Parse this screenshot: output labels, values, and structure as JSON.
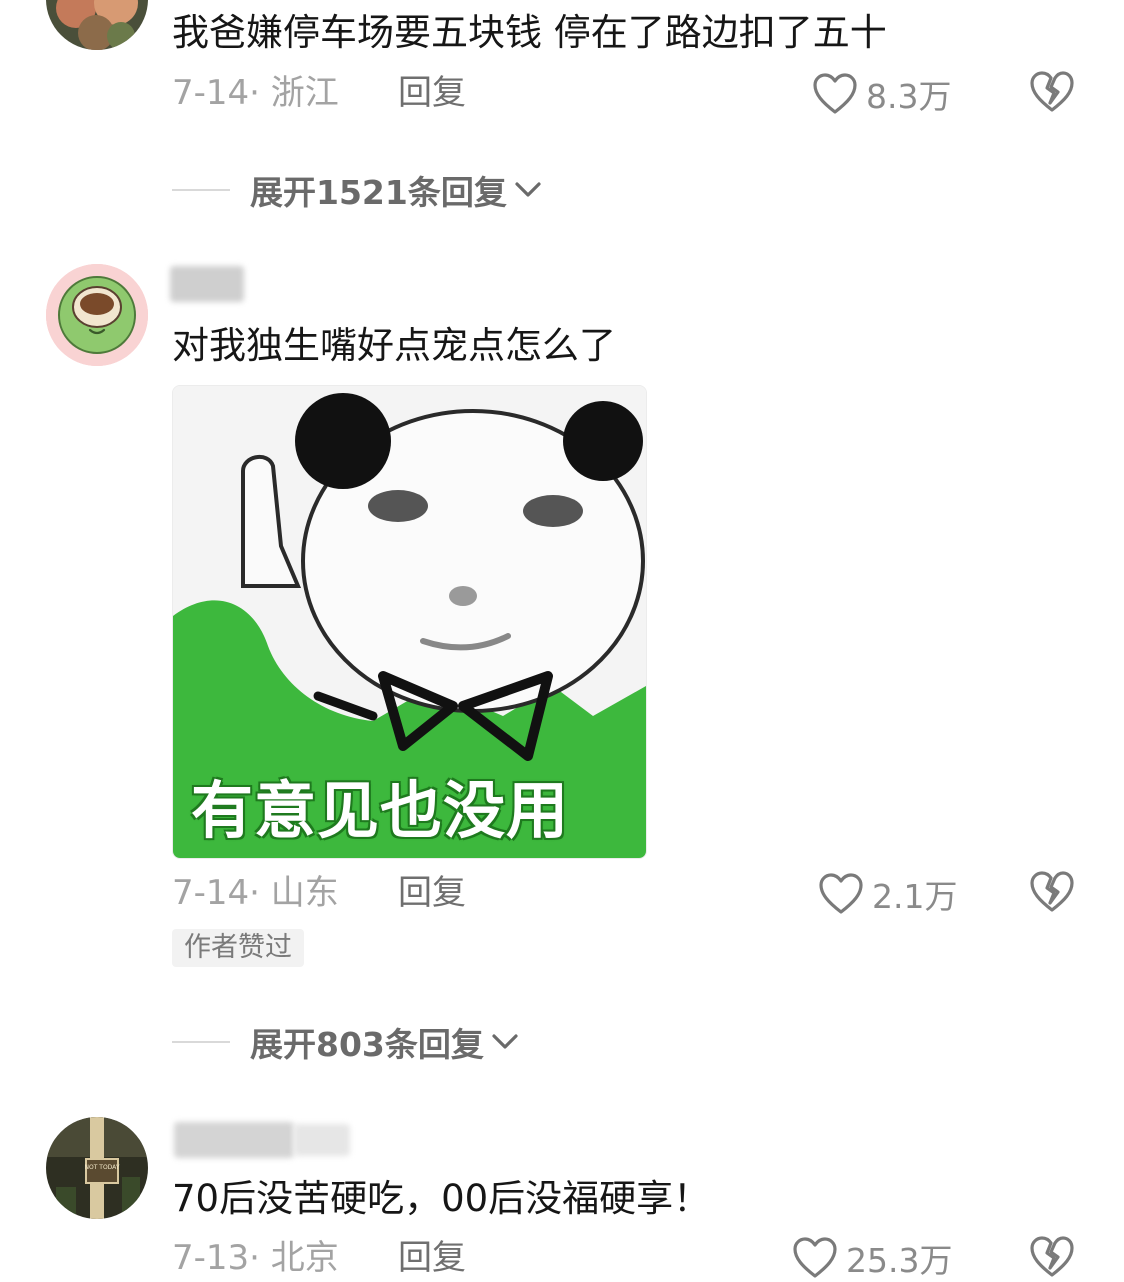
{
  "comments": [
    {
      "text": "我爸嫌停车场要五块钱 停在了路边扣了五十",
      "date_location": "7-14· 浙江",
      "reply_label": "回复",
      "likes": "8.3万",
      "expand_label": "展开1521条回复"
    },
    {
      "text": "对我独生嘴好点宠点怎么了",
      "meme_caption": "有意见也没用",
      "date_location": "7-14· 山东",
      "reply_label": "回复",
      "likes": "2.1万",
      "badge": "作者赞过",
      "expand_label": "展开803条回复"
    },
    {
      "text": "70后没苦硬吃，00后没福硬享！",
      "date_location": "7-13· 北京",
      "reply_label": "回复",
      "likes": "25.3万",
      "avatar_sign_text": "NOT TODAY"
    }
  ],
  "colors": {
    "meta_gray": "#a3a3a3",
    "meme_green": "#3db83d",
    "icon_gray": "#7a7a7a"
  },
  "icons": {
    "like": "heart-outline-icon",
    "dislike": "broken-heart-icon",
    "expand": "chevron-down-icon"
  }
}
